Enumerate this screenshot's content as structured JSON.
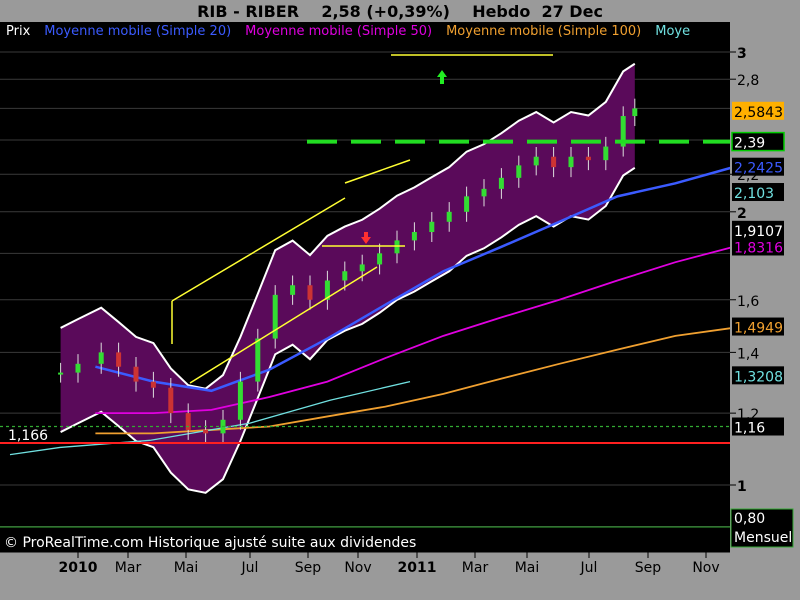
{
  "header": {
    "symbol": "RIB - RIBER",
    "quote": "2,58 (+0,39%)",
    "period": "Hebdo",
    "date": "27 Dec"
  },
  "legend": [
    {
      "label": "Prix",
      "color": "#ffffff"
    },
    {
      "label": "Moyenne mobile (Simple 20)",
      "color": "#3b5bff"
    },
    {
      "label": "Moyenne mobile (Simple 50)",
      "color": "#e000e0"
    },
    {
      "label": "Moyenne mobile (Simple 100)",
      "color": "#f0a030"
    },
    {
      "label": "Moye",
      "color": "#70e0e0"
    }
  ],
  "credit": "© ProRealTime.com Historique ajusté suite aux dividendes",
  "axis": {
    "y_ticks": [
      "3",
      "2,8",
      "2,2",
      "2",
      "1,6",
      "1,4",
      "1,2",
      "1"
    ],
    "x_ticks": [
      "2010",
      "Mar",
      "Mai",
      "Jul",
      "Sep",
      "Nov",
      "2011",
      "Mar",
      "Mai",
      "Jul",
      "Sep",
      "Nov"
    ],
    "x_bold": [
      "2010",
      "2011"
    ]
  },
  "price_labels": [
    {
      "text": "2,5843",
      "value": 2.5843,
      "bg": "#ffb000",
      "fg": "#000000"
    },
    {
      "text": "2,39",
      "value": 2.39,
      "bg": "#000000",
      "fg": "#ffffff",
      "border": "#00cc00"
    },
    {
      "text": "2,2425",
      "value": 2.2425,
      "bg": "#000000",
      "fg": "#3b5bff"
    },
    {
      "text": "2,103",
      "value": 2.103,
      "bg": "#000000",
      "fg": "#70e0e0"
    },
    {
      "text": "1,9107",
      "value": 1.9107,
      "bg": "#000000",
      "fg": "#ffffff"
    },
    {
      "text": "1,8316",
      "value": 1.8316,
      "bg": "#000000",
      "fg": "#e000e0"
    },
    {
      "text": "1,4949",
      "value": 1.4949,
      "bg": "#000000",
      "fg": "#f0a030"
    },
    {
      "text": "1,3208",
      "value": 1.3208,
      "bg": "#000000",
      "fg": "#70e0e0"
    },
    {
      "text": "1,16",
      "value": 1.16,
      "bg": "#000000",
      "fg": "#ffffff"
    }
  ],
  "volume_box": {
    "value": "0,80",
    "label": "Mensuel"
  },
  "annotation_left": "1,166",
  "chart_data": {
    "type": "line",
    "title": "RIB - RIBER  2,58 (+0,39%)  Hebdo  27 Dec",
    "ylim": [
      0.8,
      3.05
    ],
    "x_periods": [
      "2010-01",
      "2010-02",
      "2010-03",
      "2010-04",
      "2010-05",
      "2010-06",
      "2010-07",
      "2010-08",
      "2010-09",
      "2010-10",
      "2010-11",
      "2010-12"
    ],
    "series": [
      {
        "name": "Prix",
        "values": [
          1.32,
          1.28,
          1.16,
          1.35,
          1.65,
          1.7,
          1.9,
          1.97,
          2.12,
          2.3,
          2.28,
          2.58
        ]
      },
      {
        "name": "Moyenne mobile (Simple 20)",
        "values": [
          1.35,
          1.3,
          1.27,
          1.34,
          1.45,
          1.58,
          1.72,
          1.83,
          1.95,
          2.08,
          2.15,
          2.24
        ]
      },
      {
        "name": "Moyenne mobile (Simple 50)",
        "values": [
          1.2,
          1.2,
          1.21,
          1.25,
          1.3,
          1.38,
          1.46,
          1.53,
          1.6,
          1.68,
          1.76,
          1.83
        ]
      },
      {
        "name": "Moyenne mobile (Simple 100)",
        "values": [
          1.14,
          1.14,
          1.15,
          1.16,
          1.19,
          1.22,
          1.26,
          1.31,
          1.36,
          1.41,
          1.46,
          1.49
        ]
      }
    ],
    "hlines": [
      2.39,
      1.2,
      1.16
    ],
    "grid": true
  }
}
